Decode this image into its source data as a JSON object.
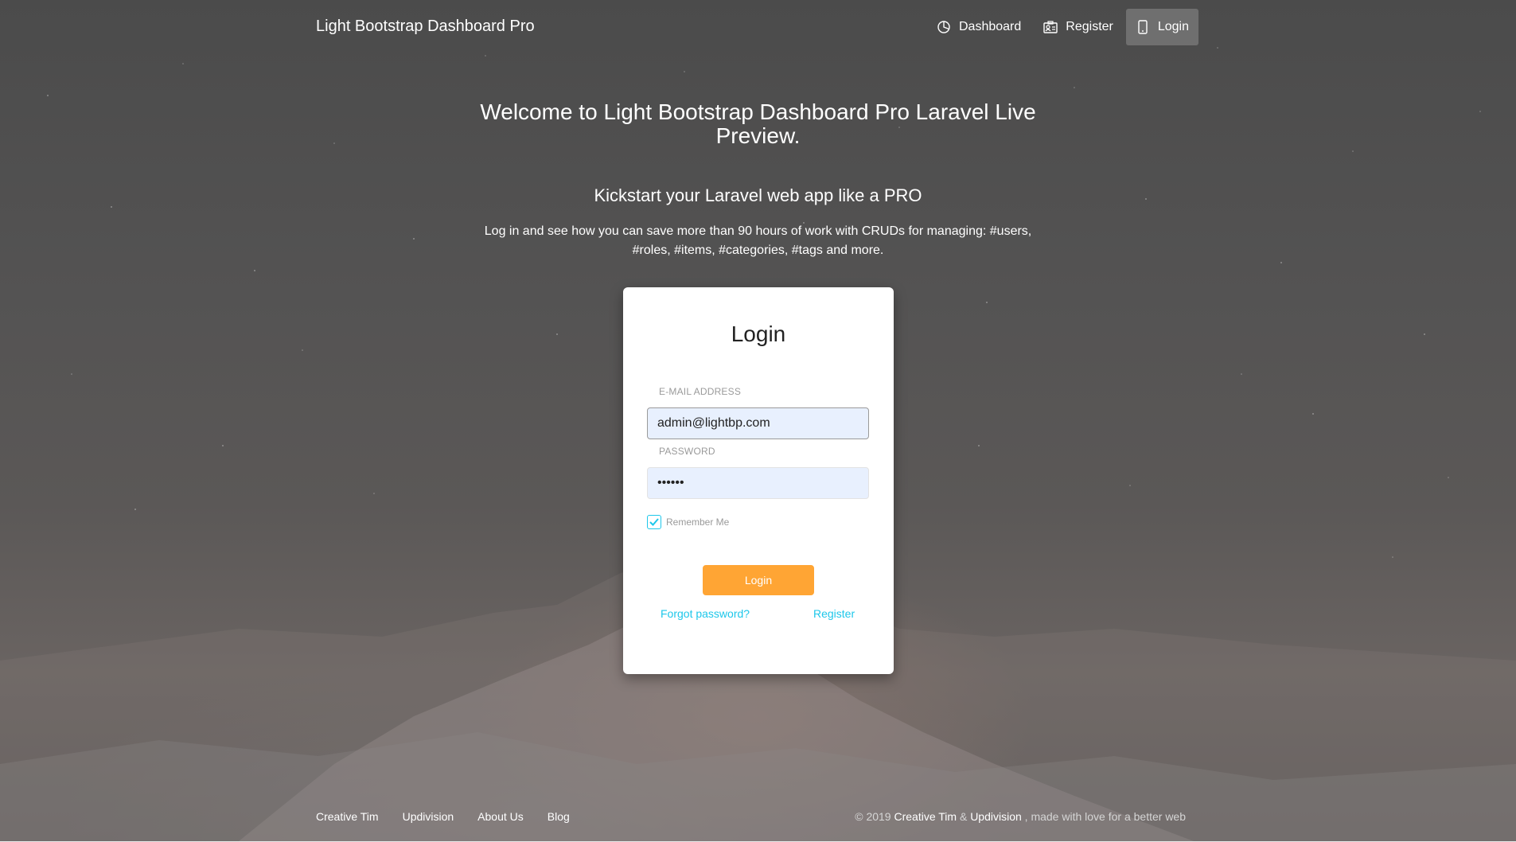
{
  "navbar": {
    "brand": "Light Bootstrap Dashboard Pro",
    "items": [
      {
        "label": "Dashboard",
        "icon": "chart-pie-icon"
      },
      {
        "label": "Register",
        "icon": "badge-icon"
      },
      {
        "label": "Login",
        "icon": "mobile-icon",
        "active": true
      }
    ]
  },
  "hero": {
    "title": "Welcome to Light Bootstrap Dashboard Pro Laravel Live Preview.",
    "subtitle": "Kickstart your Laravel web app like a PRO",
    "description": "Log in and see how you can save more than 90 hours of work with CRUDs for managing: #users, #roles, #items, #categories, #tags and more."
  },
  "login_card": {
    "title": "Login",
    "email_label": "E-MAIL ADDRESS",
    "email_value": "admin@lightbp.com",
    "password_label": "PASSWORD",
    "password_value": "secret",
    "remember_label": "Remember Me",
    "remember_checked": true,
    "submit_label": "Login",
    "forgot_label": "Forgot password?",
    "register_label": "Register"
  },
  "footer": {
    "links": [
      "Creative Tim",
      "Updivision",
      "About Us",
      "Blog"
    ],
    "copyright_prefix": "© 2019",
    "copyright_author1": "Creative Tim",
    "copyright_amp": "&",
    "copyright_author2": "Updivision",
    "copyright_suffix": ", made with love for a better web"
  },
  "colors": {
    "accent_orange": "#ffa534",
    "link_cyan": "#1dc7ea",
    "input_bg": "#e8f0fe"
  }
}
